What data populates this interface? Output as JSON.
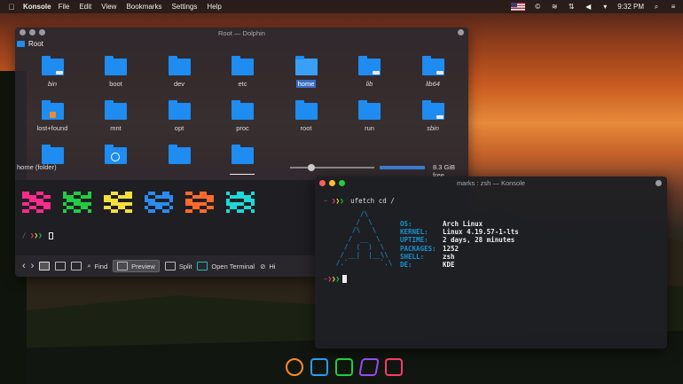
{
  "menubar": {
    "app_name": "Konsole",
    "menus": [
      "File",
      "Edit",
      "View",
      "Bookmarks",
      "Settings",
      "Help"
    ],
    "time": "9:32 PM"
  },
  "dolphin": {
    "title": "Root — Dolphin",
    "location": "Root",
    "folders": [
      {
        "name": "bin",
        "italic": true,
        "badge": "link"
      },
      {
        "name": "boot",
        "italic": false,
        "badge": ""
      },
      {
        "name": "dev",
        "italic": false,
        "badge": ""
      },
      {
        "name": "etc",
        "italic": false,
        "badge": ""
      },
      {
        "name": "home",
        "italic": false,
        "badge": "",
        "selected": true
      },
      {
        "name": "lib",
        "italic": true,
        "badge": "link"
      },
      {
        "name": "lib64",
        "italic": true,
        "badge": "link"
      },
      {
        "name": "lost+found",
        "italic": false,
        "badge": "lock"
      },
      {
        "name": "mnt",
        "italic": false,
        "badge": ""
      },
      {
        "name": "opt",
        "italic": false,
        "badge": ""
      },
      {
        "name": "proc",
        "italic": false,
        "badge": ""
      },
      {
        "name": "root",
        "italic": false,
        "badge": ""
      },
      {
        "name": "run",
        "italic": false,
        "badge": ""
      },
      {
        "name": "sbin",
        "italic": true,
        "badge": "link"
      },
      {
        "name": "",
        "italic": false,
        "badge": ""
      },
      {
        "name": "",
        "italic": false,
        "badge": "clock"
      },
      {
        "name": "",
        "italic": false,
        "badge": ""
      },
      {
        "name": "",
        "italic": false,
        "badge": ""
      }
    ],
    "status": "home (folder)",
    "free_space": "8.3 GiB free",
    "zoom_fraction": 0.25,
    "space_used_fraction": 0.9,
    "prompt": "/ ❯❯❯ ",
    "toolbar": {
      "find": "Find",
      "preview": "Preview",
      "split": "Split",
      "open_terminal": "Open Terminal",
      "hidden": "Hi"
    }
  },
  "konsole": {
    "title": "marks : zsh — Konsole",
    "command": "ufetch cd /",
    "arch_art": "        /\\\n       /  \\\n      /\\   \\\n     /  __  \\\n    /  (  )  \\\n   / __|  |__\\\\\n  /.`        `.\\",
    "info": [
      {
        "key": "OS:",
        "value": "Arch Linux"
      },
      {
        "key": "KERNEL:",
        "value": "Linux 4.19.57-1-lts"
      },
      {
        "key": "UPTIME:",
        "value": "2 days, 28 minutes"
      },
      {
        "key": "PACKAGES:",
        "value": "1252"
      },
      {
        "key": "SHELL:",
        "value": "zsh"
      },
      {
        "key": "DE:",
        "value": "KDE"
      }
    ]
  },
  "colors": {
    "accent": "#1e8cf0",
    "arch_blue": "#1793d1",
    "block_colors": [
      "#ff2a8a",
      "#22cc44",
      "#f4e03a",
      "#2a8cf0",
      "#ff6a2a",
      "#1ed8d8"
    ],
    "dots": [
      "#ff5f56",
      "#ffbd2e",
      "#27c93f"
    ],
    "chevrons": [
      "#ff3a6a",
      "#f4e03a",
      "#22cc44"
    ]
  },
  "dock": [
    "firefox-icon",
    "terminal-icon",
    "files-icon",
    "visual-studio-icon",
    "sublime-icon"
  ]
}
